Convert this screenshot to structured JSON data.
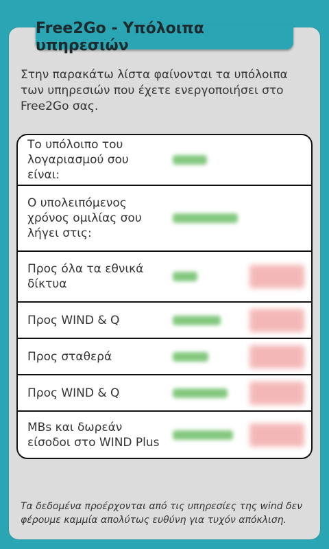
{
  "title": "Free2Go - Υπόλοιπα υπηρεσιών",
  "intro": "Στην παρακάτω λίστα φαίνονται τα υπόλοιπα των υπηρεσιών που έχετε ενεργοποιήσει στο Free2Go σας.",
  "rows": [
    {
      "label": "Το υπόλοιπο του λογαριασμού σου είναι:"
    },
    {
      "label": "Ο υπολειπόμενος χρόνος ομιλίας σου λήγει στις:"
    },
    {
      "label": "Προς όλα τα εθνικά δίκτυα"
    },
    {
      "label": "Προς WIND & Q"
    },
    {
      "label": "Προς σταθερά"
    },
    {
      "label": "Προς WIND & Q"
    },
    {
      "label": "MBs και δωρεάν είσοδοι στο WIND Plus"
    }
  ],
  "footer": "Τα δεδομένα προέρχονται από τις υπηρεσίες της wind δεν φέρουμε καμμία απολύτως ευθύνη για τυχόν απόκλιση.",
  "colors": {
    "accent": "#2aa5b3",
    "card": "#dcdcdc"
  }
}
